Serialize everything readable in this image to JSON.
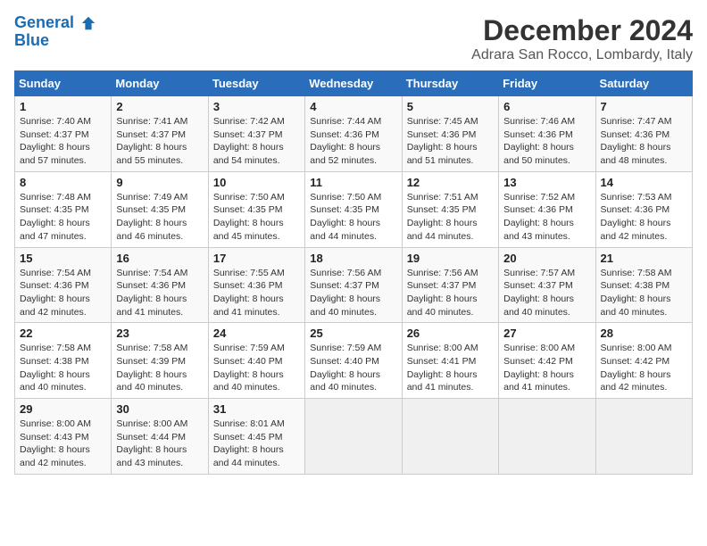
{
  "logo": {
    "line1": "General",
    "line2": "Blue"
  },
  "title": "December 2024",
  "location": "Adrara San Rocco, Lombardy, Italy",
  "days_of_week": [
    "Sunday",
    "Monday",
    "Tuesday",
    "Wednesday",
    "Thursday",
    "Friday",
    "Saturday"
  ],
  "weeks": [
    [
      {
        "day": "1",
        "info": "Sunrise: 7:40 AM\nSunset: 4:37 PM\nDaylight: 8 hours\nand 57 minutes."
      },
      {
        "day": "2",
        "info": "Sunrise: 7:41 AM\nSunset: 4:37 PM\nDaylight: 8 hours\nand 55 minutes."
      },
      {
        "day": "3",
        "info": "Sunrise: 7:42 AM\nSunset: 4:37 PM\nDaylight: 8 hours\nand 54 minutes."
      },
      {
        "day": "4",
        "info": "Sunrise: 7:44 AM\nSunset: 4:36 PM\nDaylight: 8 hours\nand 52 minutes."
      },
      {
        "day": "5",
        "info": "Sunrise: 7:45 AM\nSunset: 4:36 PM\nDaylight: 8 hours\nand 51 minutes."
      },
      {
        "day": "6",
        "info": "Sunrise: 7:46 AM\nSunset: 4:36 PM\nDaylight: 8 hours\nand 50 minutes."
      },
      {
        "day": "7",
        "info": "Sunrise: 7:47 AM\nSunset: 4:36 PM\nDaylight: 8 hours\nand 48 minutes."
      }
    ],
    [
      {
        "day": "8",
        "info": "Sunrise: 7:48 AM\nSunset: 4:35 PM\nDaylight: 8 hours\nand 47 minutes."
      },
      {
        "day": "9",
        "info": "Sunrise: 7:49 AM\nSunset: 4:35 PM\nDaylight: 8 hours\nand 46 minutes."
      },
      {
        "day": "10",
        "info": "Sunrise: 7:50 AM\nSunset: 4:35 PM\nDaylight: 8 hours\nand 45 minutes."
      },
      {
        "day": "11",
        "info": "Sunrise: 7:50 AM\nSunset: 4:35 PM\nDaylight: 8 hours\nand 44 minutes."
      },
      {
        "day": "12",
        "info": "Sunrise: 7:51 AM\nSunset: 4:35 PM\nDaylight: 8 hours\nand 44 minutes."
      },
      {
        "day": "13",
        "info": "Sunrise: 7:52 AM\nSunset: 4:36 PM\nDaylight: 8 hours\nand 43 minutes."
      },
      {
        "day": "14",
        "info": "Sunrise: 7:53 AM\nSunset: 4:36 PM\nDaylight: 8 hours\nand 42 minutes."
      }
    ],
    [
      {
        "day": "15",
        "info": "Sunrise: 7:54 AM\nSunset: 4:36 PM\nDaylight: 8 hours\nand 42 minutes."
      },
      {
        "day": "16",
        "info": "Sunrise: 7:54 AM\nSunset: 4:36 PM\nDaylight: 8 hours\nand 41 minutes."
      },
      {
        "day": "17",
        "info": "Sunrise: 7:55 AM\nSunset: 4:36 PM\nDaylight: 8 hours\nand 41 minutes."
      },
      {
        "day": "18",
        "info": "Sunrise: 7:56 AM\nSunset: 4:37 PM\nDaylight: 8 hours\nand 40 minutes."
      },
      {
        "day": "19",
        "info": "Sunrise: 7:56 AM\nSunset: 4:37 PM\nDaylight: 8 hours\nand 40 minutes."
      },
      {
        "day": "20",
        "info": "Sunrise: 7:57 AM\nSunset: 4:37 PM\nDaylight: 8 hours\nand 40 minutes."
      },
      {
        "day": "21",
        "info": "Sunrise: 7:58 AM\nSunset: 4:38 PM\nDaylight: 8 hours\nand 40 minutes."
      }
    ],
    [
      {
        "day": "22",
        "info": "Sunrise: 7:58 AM\nSunset: 4:38 PM\nDaylight: 8 hours\nand 40 minutes."
      },
      {
        "day": "23",
        "info": "Sunrise: 7:58 AM\nSunset: 4:39 PM\nDaylight: 8 hours\nand 40 minutes."
      },
      {
        "day": "24",
        "info": "Sunrise: 7:59 AM\nSunset: 4:40 PM\nDaylight: 8 hours\nand 40 minutes."
      },
      {
        "day": "25",
        "info": "Sunrise: 7:59 AM\nSunset: 4:40 PM\nDaylight: 8 hours\nand 40 minutes."
      },
      {
        "day": "26",
        "info": "Sunrise: 8:00 AM\nSunset: 4:41 PM\nDaylight: 8 hours\nand 41 minutes."
      },
      {
        "day": "27",
        "info": "Sunrise: 8:00 AM\nSunset: 4:42 PM\nDaylight: 8 hours\nand 41 minutes."
      },
      {
        "day": "28",
        "info": "Sunrise: 8:00 AM\nSunset: 4:42 PM\nDaylight: 8 hours\nand 42 minutes."
      }
    ],
    [
      {
        "day": "29",
        "info": "Sunrise: 8:00 AM\nSunset: 4:43 PM\nDaylight: 8 hours\nand 42 minutes."
      },
      {
        "day": "30",
        "info": "Sunrise: 8:00 AM\nSunset: 4:44 PM\nDaylight: 8 hours\nand 43 minutes."
      },
      {
        "day": "31",
        "info": "Sunrise: 8:01 AM\nSunset: 4:45 PM\nDaylight: 8 hours\nand 44 minutes."
      },
      null,
      null,
      null,
      null
    ]
  ]
}
